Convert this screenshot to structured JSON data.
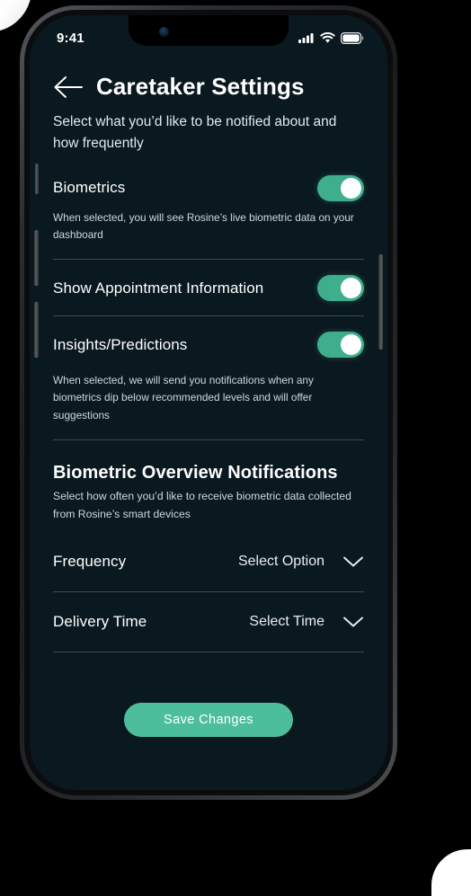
{
  "status_bar": {
    "time": "9:41",
    "icons": [
      "cellular-signal-icon",
      "wifi-icon",
      "battery-icon"
    ]
  },
  "header": {
    "back_icon": "back-arrow-icon",
    "title": "Caretaker Settings",
    "subtitle": "Select what you’d like to be notified about and how frequently"
  },
  "settings": [
    {
      "label": "Biometrics",
      "description": "When selected, you will see Rosine’s live biometric data on your dashboard",
      "toggle_state": "on"
    },
    {
      "label": "Show Appointment Information",
      "description": "",
      "toggle_state": "on"
    },
    {
      "label": "Insights/Predictions",
      "description": "When selected, we will send you notifications when any biometrics dip below recommended levels and will offer suggestions",
      "toggle_state": "on"
    }
  ],
  "notifications_section": {
    "title": "Biometric Overview Notifications",
    "description": "Select how often you’d like to receive biometric data collected from Rosine’s smart devices",
    "selects": [
      {
        "label": "Frequency",
        "value": "Select Option",
        "chevron": "chevron-down-icon"
      },
      {
        "label": "Delivery Time",
        "value": "Select Time",
        "chevron": "chevron-down-icon"
      }
    ]
  },
  "actions": {
    "save_label": "Save Changes"
  },
  "colors": {
    "screen_background": "#0a1820",
    "toggle_on": "#3fae8c",
    "save_button": "#4cbf9a",
    "divider": "#5b666d",
    "text_primary": "#ffffff",
    "text_secondary": "#cfd8dd"
  }
}
